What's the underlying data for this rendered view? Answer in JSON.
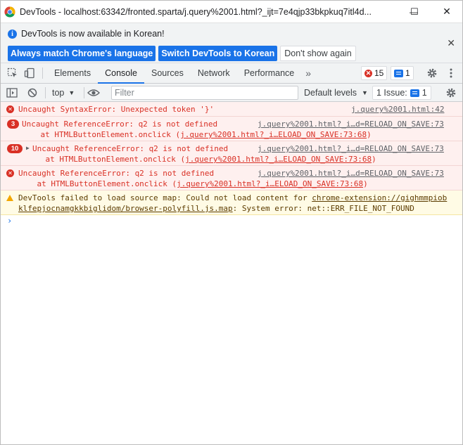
{
  "window": {
    "title": "DevTools - localhost:63342/fronted.sparta/j.query%2001.html?_ijt=7e4qjp33bkpkuq7itl4d...",
    "controls": {
      "minimize": "—",
      "maximize": "☐",
      "close": "✕"
    }
  },
  "infobar": {
    "message": "DevTools is now available in Korean!",
    "buttons": {
      "match": "Always match Chrome's language",
      "switch": "Switch DevTools to Korean",
      "dismiss": "Don't show again"
    },
    "close": "✕"
  },
  "tabs": {
    "items": [
      "Elements",
      "Console",
      "Sources",
      "Network",
      "Performance"
    ],
    "active": "Console",
    "more": "»",
    "error_count": "15",
    "issue_count": "1"
  },
  "console_toolbar": {
    "context": "top",
    "filter_placeholder": "Filter",
    "levels": "Default levels",
    "issues_label": "1 Issue:",
    "issues_count": "1"
  },
  "messages": [
    {
      "type": "error",
      "count": "",
      "text": "Uncaught SyntaxError: Unexpected token '}'",
      "source": "j.query%2001.html:42",
      "stack": ""
    },
    {
      "type": "error",
      "count": "3",
      "text": "Uncaught ReferenceError: q2 is not defined",
      "source": "j.query%2001.html?_i…d=RELOAD_ON_SAVE:73",
      "stack_prefix": "    at HTMLButtonElement.onclick (",
      "stack_link": "j.query%2001.html?_i…ELOAD_ON_SAVE:73:68",
      "stack_suffix": ")"
    },
    {
      "type": "error",
      "count": "10",
      "text": "Uncaught ReferenceError: q2 is not defined",
      "source": "j.query%2001.html?_i…d=RELOAD_ON_SAVE:73",
      "stack_prefix": "    at HTMLButtonElement.onclick (",
      "stack_link": "j.query%2001.html?_i…ELOAD_ON_SAVE:73:68",
      "stack_suffix": ")"
    },
    {
      "type": "error",
      "count": "",
      "text": "Uncaught ReferenceError: q2 is not defined",
      "source": "j.query%2001.html?_i…d=RELOAD_ON_SAVE:73",
      "stack_prefix": "    at HTMLButtonElement.onclick (",
      "stack_link": "j.query%2001.html?_i…ELOAD_ON_SAVE:73:68",
      "stack_suffix": ")"
    },
    {
      "type": "warning",
      "text_prefix": "DevTools failed to load source map: Could not load content for ",
      "link_part1": "chrome-extension://gighmmpiob",
      "link_part2": "klfepjocnamgkkbiglidom/browser-polyfill.js.map",
      "text_suffix": ": System error: net::ERR_FILE_NOT_FOUND"
    }
  ],
  "prompt": "›",
  "colors": {
    "accent": "#1a73e8",
    "error": "#d93025",
    "error_bg": "#fef0ef",
    "warning_bg": "#fffbe5",
    "toolbar_bg": "#f1f3f4"
  }
}
